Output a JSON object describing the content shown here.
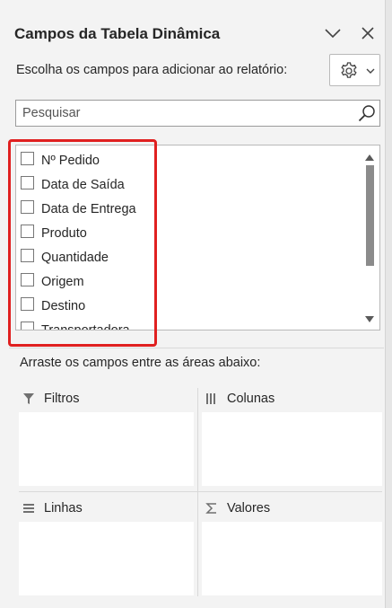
{
  "pane": {
    "title": "Campos da Tabela Dinâmica",
    "subtitle": "Escolha os campos para adicionar ao relatório:"
  },
  "search": {
    "placeholder": "Pesquisar"
  },
  "fields": [
    {
      "label": "Nº Pedido",
      "checked": false
    },
    {
      "label": "Data de Saída",
      "checked": false
    },
    {
      "label": "Data de Entrega",
      "checked": false
    },
    {
      "label": "Produto",
      "checked": false
    },
    {
      "label": "Quantidade",
      "checked": false
    },
    {
      "label": "Origem",
      "checked": false
    },
    {
      "label": "Destino",
      "checked": false
    },
    {
      "label": "Transportadora",
      "checked": false
    }
  ],
  "drag_hint": "Arraste os campos entre as áreas abaixo:",
  "areas": {
    "filters": "Filtros",
    "columns": "Colunas",
    "rows": "Linhas",
    "values": "Valores"
  },
  "colors": {
    "highlight": "#e02020",
    "pane_bg": "#f3f3f3"
  },
  "icons": [
    "chevron-down-icon",
    "close-icon",
    "gear-icon",
    "search-icon",
    "filter-icon",
    "columns-icon",
    "rows-icon",
    "sigma-icon"
  ]
}
